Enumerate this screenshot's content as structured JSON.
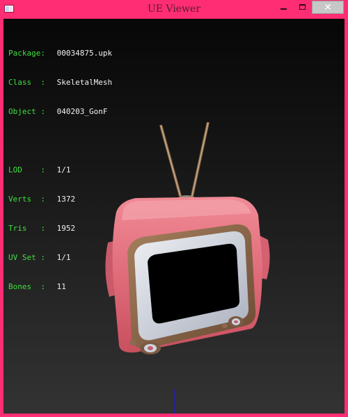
{
  "window": {
    "title": "UE Viewer",
    "controls": {
      "minimize": "minimize-icon",
      "maximize": "maximize-icon",
      "close": "close-icon"
    }
  },
  "info": {
    "package": {
      "label": "Package:",
      "value": "00034875.upk"
    },
    "class": {
      "label": "Class  :",
      "value": "SkeletalMesh"
    },
    "object": {
      "label": "Object :",
      "value": "040203_GonF"
    },
    "lod": {
      "label": "LOD    :",
      "value": "1/1"
    },
    "verts": {
      "label": "Verts  :",
      "value": "1372"
    },
    "tris": {
      "label": "Tris   :",
      "value": "1952"
    },
    "uvset": {
      "label": "UV Set :",
      "value": "1/1"
    },
    "bones": {
      "label": "Bones  :",
      "value": "11"
    }
  },
  "colors": {
    "frame": "#ff2d74",
    "label_green": "#3fe03f",
    "value_white": "#f2f2f2",
    "tv_body": "#e8727e",
    "axis_blue": "#1e1eb4"
  }
}
